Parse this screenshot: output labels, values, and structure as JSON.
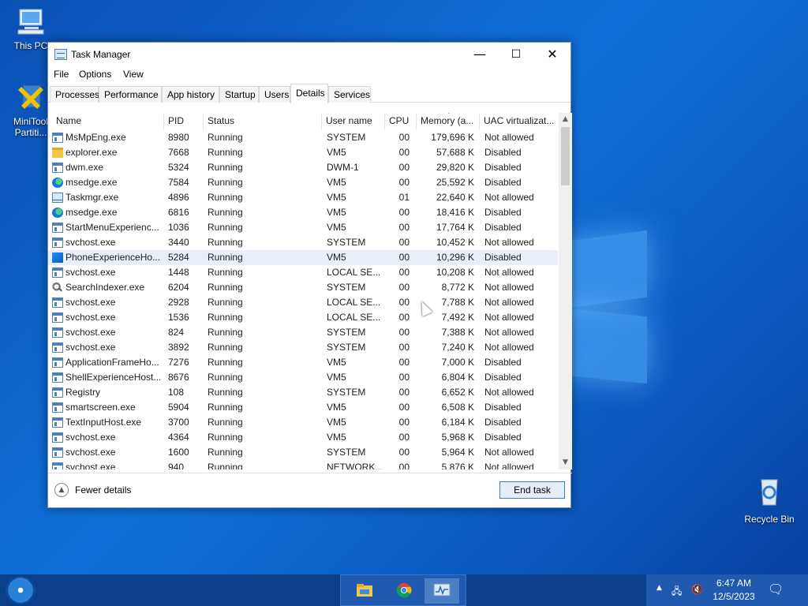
{
  "desktop": {
    "icons": [
      {
        "label": "This PC"
      },
      {
        "label": "MiniTool Partiti..."
      },
      {
        "label": "Recycle Bin"
      }
    ]
  },
  "window": {
    "title": "Task Manager",
    "controls": {
      "minimize": "—",
      "maximize": "☐",
      "close": "✕"
    }
  },
  "menu": [
    "File",
    "Options",
    "View"
  ],
  "tabs": [
    "Processes",
    "Performance",
    "App history",
    "Startup",
    "Users",
    "Details",
    "Services"
  ],
  "active_tab": "Details",
  "columns": [
    "Name",
    "PID",
    "Status",
    "User name",
    "CPU",
    "Memory (a...",
    "UAC virtualizat..."
  ],
  "processes": [
    {
      "name": "MsMpEng.exe",
      "pid": "8980",
      "status": "Running",
      "user": "SYSTEM",
      "cpu": "00",
      "memory": "179,696 K",
      "uac": "Not allowed",
      "icon": "app-icon"
    },
    {
      "name": "explorer.exe",
      "pid": "7668",
      "status": "Running",
      "user": "VM5",
      "cpu": "00",
      "memory": "57,688 K",
      "uac": "Disabled",
      "icon": "folder-icon"
    },
    {
      "name": "dwm.exe",
      "pid": "5324",
      "status": "Running",
      "user": "DWM-1",
      "cpu": "00",
      "memory": "29,820 K",
      "uac": "Disabled",
      "icon": "app-icon"
    },
    {
      "name": "msedge.exe",
      "pid": "7584",
      "status": "Running",
      "user": "VM5",
      "cpu": "00",
      "memory": "25,592 K",
      "uac": "Disabled",
      "icon": "edge-icon"
    },
    {
      "name": "Taskmgr.exe",
      "pid": "4896",
      "status": "Running",
      "user": "VM5",
      "cpu": "01",
      "memory": "22,640 K",
      "uac": "Not allowed",
      "icon": "task-manager-icon"
    },
    {
      "name": "msedge.exe",
      "pid": "6816",
      "status": "Running",
      "user": "VM5",
      "cpu": "00",
      "memory": "18,416 K",
      "uac": "Disabled",
      "icon": "edge-icon"
    },
    {
      "name": "StartMenuExperienc...",
      "pid": "1036",
      "status": "Running",
      "user": "VM5",
      "cpu": "00",
      "memory": "17,764 K",
      "uac": "Disabled",
      "icon": "app-icon"
    },
    {
      "name": "svchost.exe",
      "pid": "3440",
      "status": "Running",
      "user": "SYSTEM",
      "cpu": "00",
      "memory": "10,452 K",
      "uac": "Not allowed",
      "icon": "app-icon"
    },
    {
      "name": "PhoneExperienceHo...",
      "pid": "5284",
      "status": "Running",
      "user": "VM5",
      "cpu": "00",
      "memory": "10,296 K",
      "uac": "Disabled",
      "icon": "phone-icon",
      "selected": true
    },
    {
      "name": "svchost.exe",
      "pid": "1448",
      "status": "Running",
      "user": "LOCAL SE...",
      "cpu": "00",
      "memory": "10,208 K",
      "uac": "Not allowed",
      "icon": "app-icon"
    },
    {
      "name": "SearchIndexer.exe",
      "pid": "6204",
      "status": "Running",
      "user": "SYSTEM",
      "cpu": "00",
      "memory": "8,772 K",
      "uac": "Not allowed",
      "icon": "search-icon"
    },
    {
      "name": "svchost.exe",
      "pid": "2928",
      "status": "Running",
      "user": "LOCAL SE...",
      "cpu": "00",
      "memory": "7,788 K",
      "uac": "Not allowed",
      "icon": "app-icon"
    },
    {
      "name": "svchost.exe",
      "pid": "1536",
      "status": "Running",
      "user": "LOCAL SE...",
      "cpu": "00",
      "memory": "7,492 K",
      "uac": "Not allowed",
      "icon": "app-icon"
    },
    {
      "name": "svchost.exe",
      "pid": "824",
      "status": "Running",
      "user": "SYSTEM",
      "cpu": "00",
      "memory": "7,388 K",
      "uac": "Not allowed",
      "icon": "app-icon"
    },
    {
      "name": "svchost.exe",
      "pid": "3892",
      "status": "Running",
      "user": "SYSTEM",
      "cpu": "00",
      "memory": "7,240 K",
      "uac": "Not allowed",
      "icon": "app-icon"
    },
    {
      "name": "ApplicationFrameHo...",
      "pid": "7276",
      "status": "Running",
      "user": "VM5",
      "cpu": "00",
      "memory": "7,000 K",
      "uac": "Disabled",
      "icon": "app-icon"
    },
    {
      "name": "ShellExperienceHost...",
      "pid": "8676",
      "status": "Running",
      "user": "VM5",
      "cpu": "00",
      "memory": "6,804 K",
      "uac": "Disabled",
      "icon": "app-icon"
    },
    {
      "name": "Registry",
      "pid": "108",
      "status": "Running",
      "user": "SYSTEM",
      "cpu": "00",
      "memory": "6,652 K",
      "uac": "Not allowed",
      "icon": "app-icon"
    },
    {
      "name": "smartscreen.exe",
      "pid": "5904",
      "status": "Running",
      "user": "VM5",
      "cpu": "00",
      "memory": "6,508 K",
      "uac": "Disabled",
      "icon": "app-icon"
    },
    {
      "name": "TextInputHost.exe",
      "pid": "3700",
      "status": "Running",
      "user": "VM5",
      "cpu": "00",
      "memory": "6,184 K",
      "uac": "Disabled",
      "icon": "app-icon"
    },
    {
      "name": "svchost.exe",
      "pid": "4364",
      "status": "Running",
      "user": "VM5",
      "cpu": "00",
      "memory": "5,968 K",
      "uac": "Disabled",
      "icon": "app-icon"
    },
    {
      "name": "svchost.exe",
      "pid": "1600",
      "status": "Running",
      "user": "SYSTEM",
      "cpu": "00",
      "memory": "5,964 K",
      "uac": "Not allowed",
      "icon": "app-icon"
    },
    {
      "name": "svchost.exe",
      "pid": "940",
      "status": "Running",
      "user": "NETWORK...",
      "cpu": "00",
      "memory": "5,876 K",
      "uac": "Not allowed",
      "icon": "app-icon"
    }
  ],
  "footer": {
    "fewer_details": "Fewer details",
    "end_task": "End task"
  },
  "taskbar": {
    "apps": [
      "file-explorer-icon",
      "chrome-icon",
      "task-manager-icon"
    ],
    "tray": {
      "time": "6:47 AM",
      "date": "12/5/2023"
    }
  }
}
